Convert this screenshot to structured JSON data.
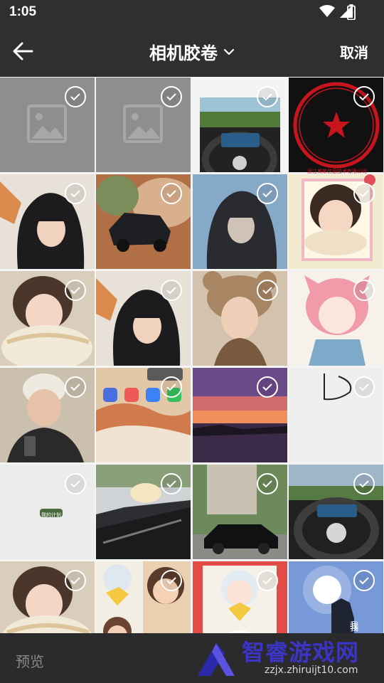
{
  "status": {
    "time": "1:05"
  },
  "header": {
    "title": "相机胶卷",
    "cancel_label": "取消"
  },
  "footer": {
    "preview_label": "预览"
  },
  "watermark": {
    "title": "智睿游戏网",
    "url": "zzjx.zhiruijt10.com"
  },
  "grid": {
    "columns": 4,
    "items": [
      {
        "desc": "image-placeholder",
        "selected": true
      },
      {
        "desc": "image-placeholder",
        "selected": true
      },
      {
        "desc": "car-steering-wheel-road",
        "selected": true
      },
      {
        "desc": "red-company-seal",
        "selected": true,
        "seal_text": "浙江某某信息技术有限公司"
      },
      {
        "desc": "hooded-person",
        "selected": true
      },
      {
        "desc": "black-suv-desert",
        "selected": true
      },
      {
        "desc": "hooded-person-window",
        "selected": true
      },
      {
        "desc": "girl-cartoon-frame",
        "selected": true
      },
      {
        "desc": "girl-in-scarf",
        "selected": true
      },
      {
        "desc": "hooded-person",
        "selected": true
      },
      {
        "desc": "girl-bear-hat",
        "selected": true
      },
      {
        "desc": "anime-pink-hair-girl",
        "selected": true
      },
      {
        "desc": "man-in-beanie-suit",
        "selected": true
      },
      {
        "desc": "phone-home-screen",
        "selected": true
      },
      {
        "desc": "sunset-sea",
        "selected": true
      },
      {
        "desc": "white-drawing",
        "selected": true
      },
      {
        "desc": "white-page-green-button",
        "selected": true,
        "button_text": "我的计划"
      },
      {
        "desc": "car-interior-window",
        "selected": true
      },
      {
        "desc": "black-sedan-garden",
        "selected": true
      },
      {
        "desc": "car-steering-wheel-road",
        "selected": true
      },
      {
        "desc": "girl-in-scarf",
        "selected": true
      },
      {
        "desc": "anime-kids-collage",
        "selected": true
      },
      {
        "desc": "anime-boy-red",
        "selected": true
      },
      {
        "desc": "hand-sun-sky",
        "selected": true,
        "caption": "我"
      }
    ]
  },
  "colors": {
    "app_bar": "#2f2f31",
    "check": "#ffffff",
    "seal_red": "#c8141c",
    "watermark_blue": "#3a34c7"
  }
}
